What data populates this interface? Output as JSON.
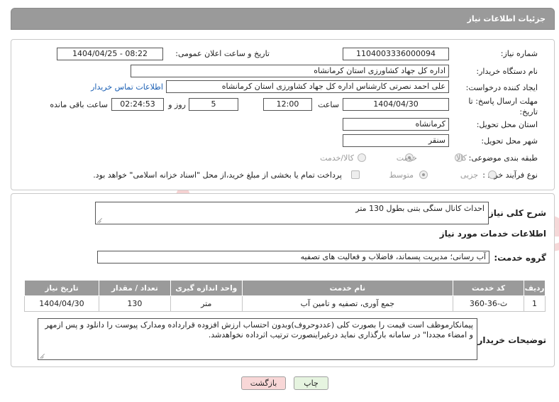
{
  "header": {
    "title": "جزئیات اطلاعات نیاز"
  },
  "form": {
    "need_number": {
      "label": "شماره نیاز:",
      "value": "1104003336000094"
    },
    "announce_datetime": {
      "label": "تاریخ و ساعت اعلان عمومی:",
      "value": "1404/04/25 - 08:22"
    },
    "buyer_org": {
      "label": "نام دستگاه خریدار:",
      "value": "اداره کل جهاد کشاورزی استان کرمانشاه"
    },
    "requester": {
      "label": "ایجاد کننده درخواست:",
      "value": "علی احمد نصرتی کارشناس اداره کل جهاد کشاورزی استان کرمانشاه",
      "contact_link": "اطلاعات تماس خریدار"
    },
    "deadline": {
      "label_line1": "مهلت ارسال پاسخ: تا",
      "label_line2": "تاریخ:",
      "date": "1404/04/30",
      "time_label": "ساعت",
      "time": "12:00",
      "days": "5",
      "days_label": "روز و",
      "remaining": "02:24:53",
      "remaining_label": "ساعت باقی مانده"
    },
    "province": {
      "label": "استان محل تحویل:",
      "value": "کرمانشاه"
    },
    "city": {
      "label": "شهر محل تحویل:",
      "value": "سنقر"
    },
    "category": {
      "label": "طبقه بندی موضوعی:",
      "options": [
        "کالا",
        "خدمت",
        "کالا/خدمت"
      ],
      "selected": "خدمت"
    },
    "purchase_type": {
      "label": "نوع فرآیند خرید :",
      "options": [
        "جزیی",
        "متوسط"
      ],
      "selected": "متوسط",
      "payment_note": "پرداخت تمام یا بخشی از مبلغ خرید،از محل \"اسناد خزانه اسلامی\" خواهد بود."
    }
  },
  "summary": {
    "label": "شرح کلی نیاز:",
    "value": "احداث کانال سنگی بتنی بطول 130 متر"
  },
  "services_title": "اطلاعات خدمات مورد نیاز",
  "service_group": {
    "label": "گروه خدمت:",
    "value": "آب رسانی؛ مدیریت پسماند، فاضلاب و فعالیت های تصفیه"
  },
  "table": {
    "headers": [
      "ردیف",
      "کد خدمت",
      "نام خدمت",
      "واحد اندازه گیری",
      "تعداد / مقدار",
      "تاریخ نیاز"
    ],
    "rows": [
      [
        "1",
        "ث-36-360",
        "جمع آوری، تصفیه و تامین آب",
        "متر",
        "130",
        "1404/04/30"
      ]
    ]
  },
  "buyer_notes": {
    "label": "توضیحات خریدار:",
    "value": "پیمانکارموظف است قیمت را بصورت کلی (عددوحروف)وبدون احتساب ارزش افزوده قرارداده ومدارک پیوست را دانلود و پس ازمهر و امضاء مجددا\"  در سامانه بارگذاری نماید درغیراینصورت ترتیب اثرداده نخواهدشد."
  },
  "buttons": {
    "print": "چاپ",
    "back": "بازگشت"
  },
  "watermark_text": "AriaTender.neT",
  "colors": {
    "header_bg": "#9a9a9a",
    "link": "#1a5fb4",
    "back_button_bg": "#f8d7d7",
    "print_button_bg": "#e6f4e0",
    "watermark": "#f2c7c7"
  }
}
